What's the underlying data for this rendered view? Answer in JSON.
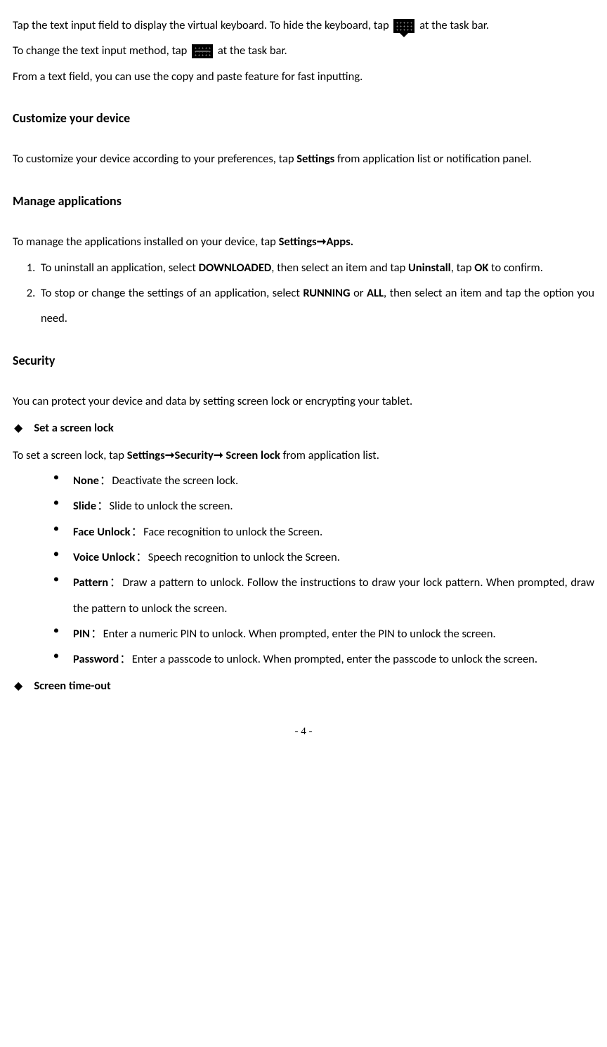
{
  "intro": {
    "p1_a": "Tap the text input field to display the virtual keyboard. To hide the keyboard, tap ",
    "p1_b": " at the task bar.",
    "p2_a": "To change the text input method, tap ",
    "p2_b": " at the task bar.",
    "p3": "From a text field, you can use the copy and paste feature for fast inputting."
  },
  "customize": {
    "heading": "Customize your device",
    "p_a": "To customize your device according to your preferences, tap ",
    "p_settings": "Settings",
    "p_b": " from application list or notification panel."
  },
  "manage": {
    "heading": "Manage applications",
    "p_a": "To manage the applications installed on your device, tap ",
    "p_settings": "Settings",
    "p_apps": "Apps.",
    "li1_a": "To uninstall an application, select ",
    "li1_downloaded": "DOWNLOADED",
    "li1_b": ", then select an item and tap ",
    "li1_uninstall": "Uninstall",
    "li1_c": ", tap ",
    "li1_ok": "OK",
    "li1_d": " to confirm.",
    "li2_a": "To stop or change the settings of an application, select ",
    "li2_running": "RUNNING",
    "li2_or": " or ",
    "li2_all": "ALL",
    "li2_b": ", then select an item and tap the option you need."
  },
  "security": {
    "heading": "Security",
    "intro": "You can protect your device and data by setting screen lock or encrypting your tablet.",
    "set_screen_lock": "Set a screen lock",
    "set_p_a": "To set a screen lock, tap ",
    "set_settings": "Settings",
    "set_security": "Security",
    "set_screenlock": " Screen lock",
    "set_p_b": " from application list.",
    "none_l": "None",
    "none_t": "Deactivate the screen lock.",
    "slide_l": "Slide",
    "slide_t": "Slide to unlock the screen.",
    "face_l": "Face Unlock",
    "face_t": "Face recognition to unlock the Screen.",
    "voice_l": "Voice Unlock",
    "voice_t": "Speech recognition to unlock the Screen.",
    "pattern_l": "Pattern",
    "pattern_t": "Draw a pattern to unlock. Follow the instructions to draw your lock pattern. When prompted, draw the pattern to unlock the screen.",
    "pin_l": "PIN",
    "pin_t": "Enter a numeric PIN to unlock. When prompted, enter the PIN to unlock the screen.",
    "password_l": "Password",
    "password_t": "Enter a passcode to unlock. When prompted, enter the passcode to unlock the screen.",
    "screen_timeout": "Screen time-out"
  },
  "colon": "：",
  "arrow": "➞",
  "page_number": "- 4 -"
}
